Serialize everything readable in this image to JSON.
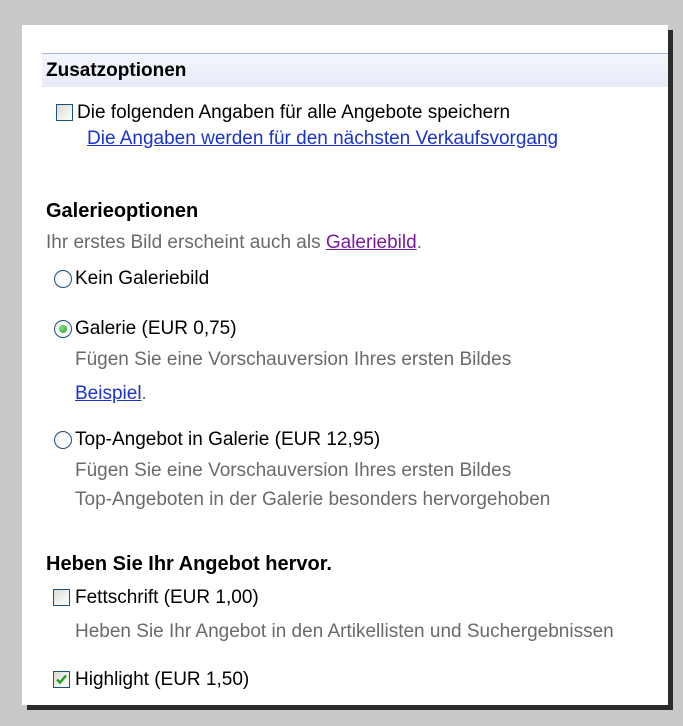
{
  "zusatz": {
    "header": "Zusatzoptionen",
    "save_label": "Die folgenden Angaben für alle Angebote speichern",
    "save_link": "Die Angaben werden für den nächsten Verkaufsvorgang"
  },
  "galerie": {
    "title": "Galerieoptionen",
    "intro_prefix": "Ihr erstes Bild erscheint auch als",
    "intro_link": "Galeriebild",
    "intro_suffix": ".",
    "options": [
      {
        "label": "Kein Galeriebild",
        "selected": false
      },
      {
        "label": "Galerie (EUR 0,75)",
        "selected": true,
        "desc": "Fügen Sie eine Vorschauversion Ihres ersten Bildes",
        "example_link": "Beispiel",
        "example_suffix": "."
      },
      {
        "label": "Top-Angebot in Galerie (EUR 12,95)",
        "selected": false,
        "desc1": "Fügen Sie eine Vorschauversion Ihres ersten Bildes",
        "desc2": "Top-Angeboten in der Galerie besonders hervorgehoben"
      }
    ]
  },
  "highlight": {
    "title": "Heben Sie Ihr Angebot hervor.",
    "options": [
      {
        "label": "Fettschrift (EUR 1,00)",
        "checked": false,
        "desc": "Heben Sie Ihr Angebot in den Artikellisten und Suchergebnissen"
      },
      {
        "label": "Highlight (EUR 1,50)",
        "checked": true
      }
    ]
  },
  "colors": {
    "link": "#1a33cc",
    "visited_link": "#7a1aa0",
    "gray_text": "#6a6a6a",
    "header_bg": "#e7ebf8"
  }
}
